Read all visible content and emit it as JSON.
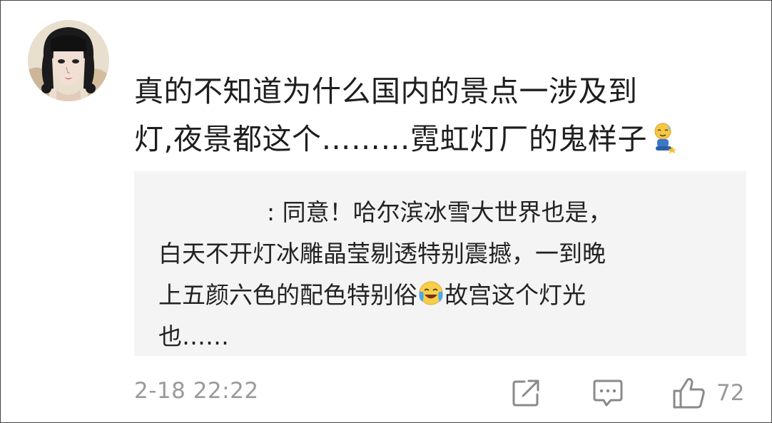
{
  "comment": {
    "text_line1": "真的不知道为什么国内的景点一涉及到",
    "text_line2": "灯,夜景都这个………霓虹灯厂的鬼样子"
  },
  "reply": {
    "line1": ": 同意！哈尔滨冰雪大世界也是，",
    "line2": "白天不开灯冰雕晶莹剔透特别震撼，一到晚",
    "line3a": "上五颜六色的配色特别俗",
    "line3b": "故宫这个灯光",
    "line4": "也……"
  },
  "meta": {
    "timestamp": "2-18 22:22",
    "like_count": "72"
  },
  "icons": {
    "share": "share-icon",
    "comment": "comment-icon",
    "like": "thumbs-up-icon",
    "emoji_inline": "sweat-squat-emoji-icon",
    "emoji_cry": "laugh-cry-emoji-icon"
  },
  "colors": {
    "reply_background": "#f4f4f4",
    "meta_gray": "#9a9a9a",
    "text": "#1e1e1e"
  }
}
